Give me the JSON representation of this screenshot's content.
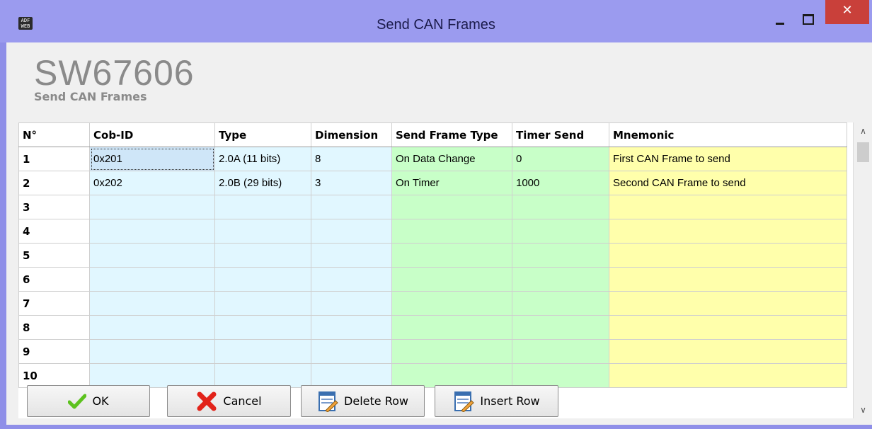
{
  "window": {
    "title": "Send CAN Frames",
    "icon_name": "adfweb-app-icon",
    "icon_text_top": "ADF",
    "icon_text_bottom": "WEB",
    "close_label": "✕"
  },
  "header": {
    "title": "SW67606",
    "subtitle": "Send CAN Frames"
  },
  "grid": {
    "columns": [
      "N°",
      "Cob-ID",
      "Type",
      "Dimension",
      "Send Frame Type",
      "Timer Send",
      "Mnemonic"
    ],
    "rows": [
      {
        "num": "1",
        "cob_id": "0x201",
        "type": "2.0A (11 bits)",
        "dimension": "8",
        "send_frame_type": "On Data Change",
        "timer_send": "0",
        "mnemonic": "First CAN Frame to send"
      },
      {
        "num": "2",
        "cob_id": "0x202",
        "type": "2.0B (29 bits)",
        "dimension": "3",
        "send_frame_type": "On Timer",
        "timer_send": "1000",
        "mnemonic": "Second CAN Frame to send"
      },
      {
        "num": "3",
        "cob_id": "",
        "type": "",
        "dimension": "",
        "send_frame_type": "",
        "timer_send": "",
        "mnemonic": ""
      },
      {
        "num": "4",
        "cob_id": "",
        "type": "",
        "dimension": "",
        "send_frame_type": "",
        "timer_send": "",
        "mnemonic": ""
      },
      {
        "num": "5",
        "cob_id": "",
        "type": "",
        "dimension": "",
        "send_frame_type": "",
        "timer_send": "",
        "mnemonic": ""
      },
      {
        "num": "6",
        "cob_id": "",
        "type": "",
        "dimension": "",
        "send_frame_type": "",
        "timer_send": "",
        "mnemonic": ""
      },
      {
        "num": "7",
        "cob_id": "",
        "type": "",
        "dimension": "",
        "send_frame_type": "",
        "timer_send": "",
        "mnemonic": ""
      },
      {
        "num": "8",
        "cob_id": "",
        "type": "",
        "dimension": "",
        "send_frame_type": "",
        "timer_send": "",
        "mnemonic": ""
      },
      {
        "num": "9",
        "cob_id": "",
        "type": "",
        "dimension": "",
        "send_frame_type": "",
        "timer_send": "",
        "mnemonic": ""
      },
      {
        "num": "10",
        "cob_id": "",
        "type": "",
        "dimension": "",
        "send_frame_type": "",
        "timer_send": "",
        "mnemonic": ""
      }
    ],
    "colors": {
      "cob_type_dim": "#e1f7ff",
      "frame_timer": "#c8ffc8",
      "mnemonic": "#ffffab"
    }
  },
  "buttons": {
    "ok": {
      "label": "OK",
      "icon": "checkmark-icon"
    },
    "cancel": {
      "label": "Cancel",
      "icon": "red-x-icon"
    },
    "delete_row": {
      "label": "Delete Row",
      "icon": "delete-row-icon"
    },
    "insert_row": {
      "label": "Insert Row",
      "icon": "insert-row-icon"
    }
  }
}
